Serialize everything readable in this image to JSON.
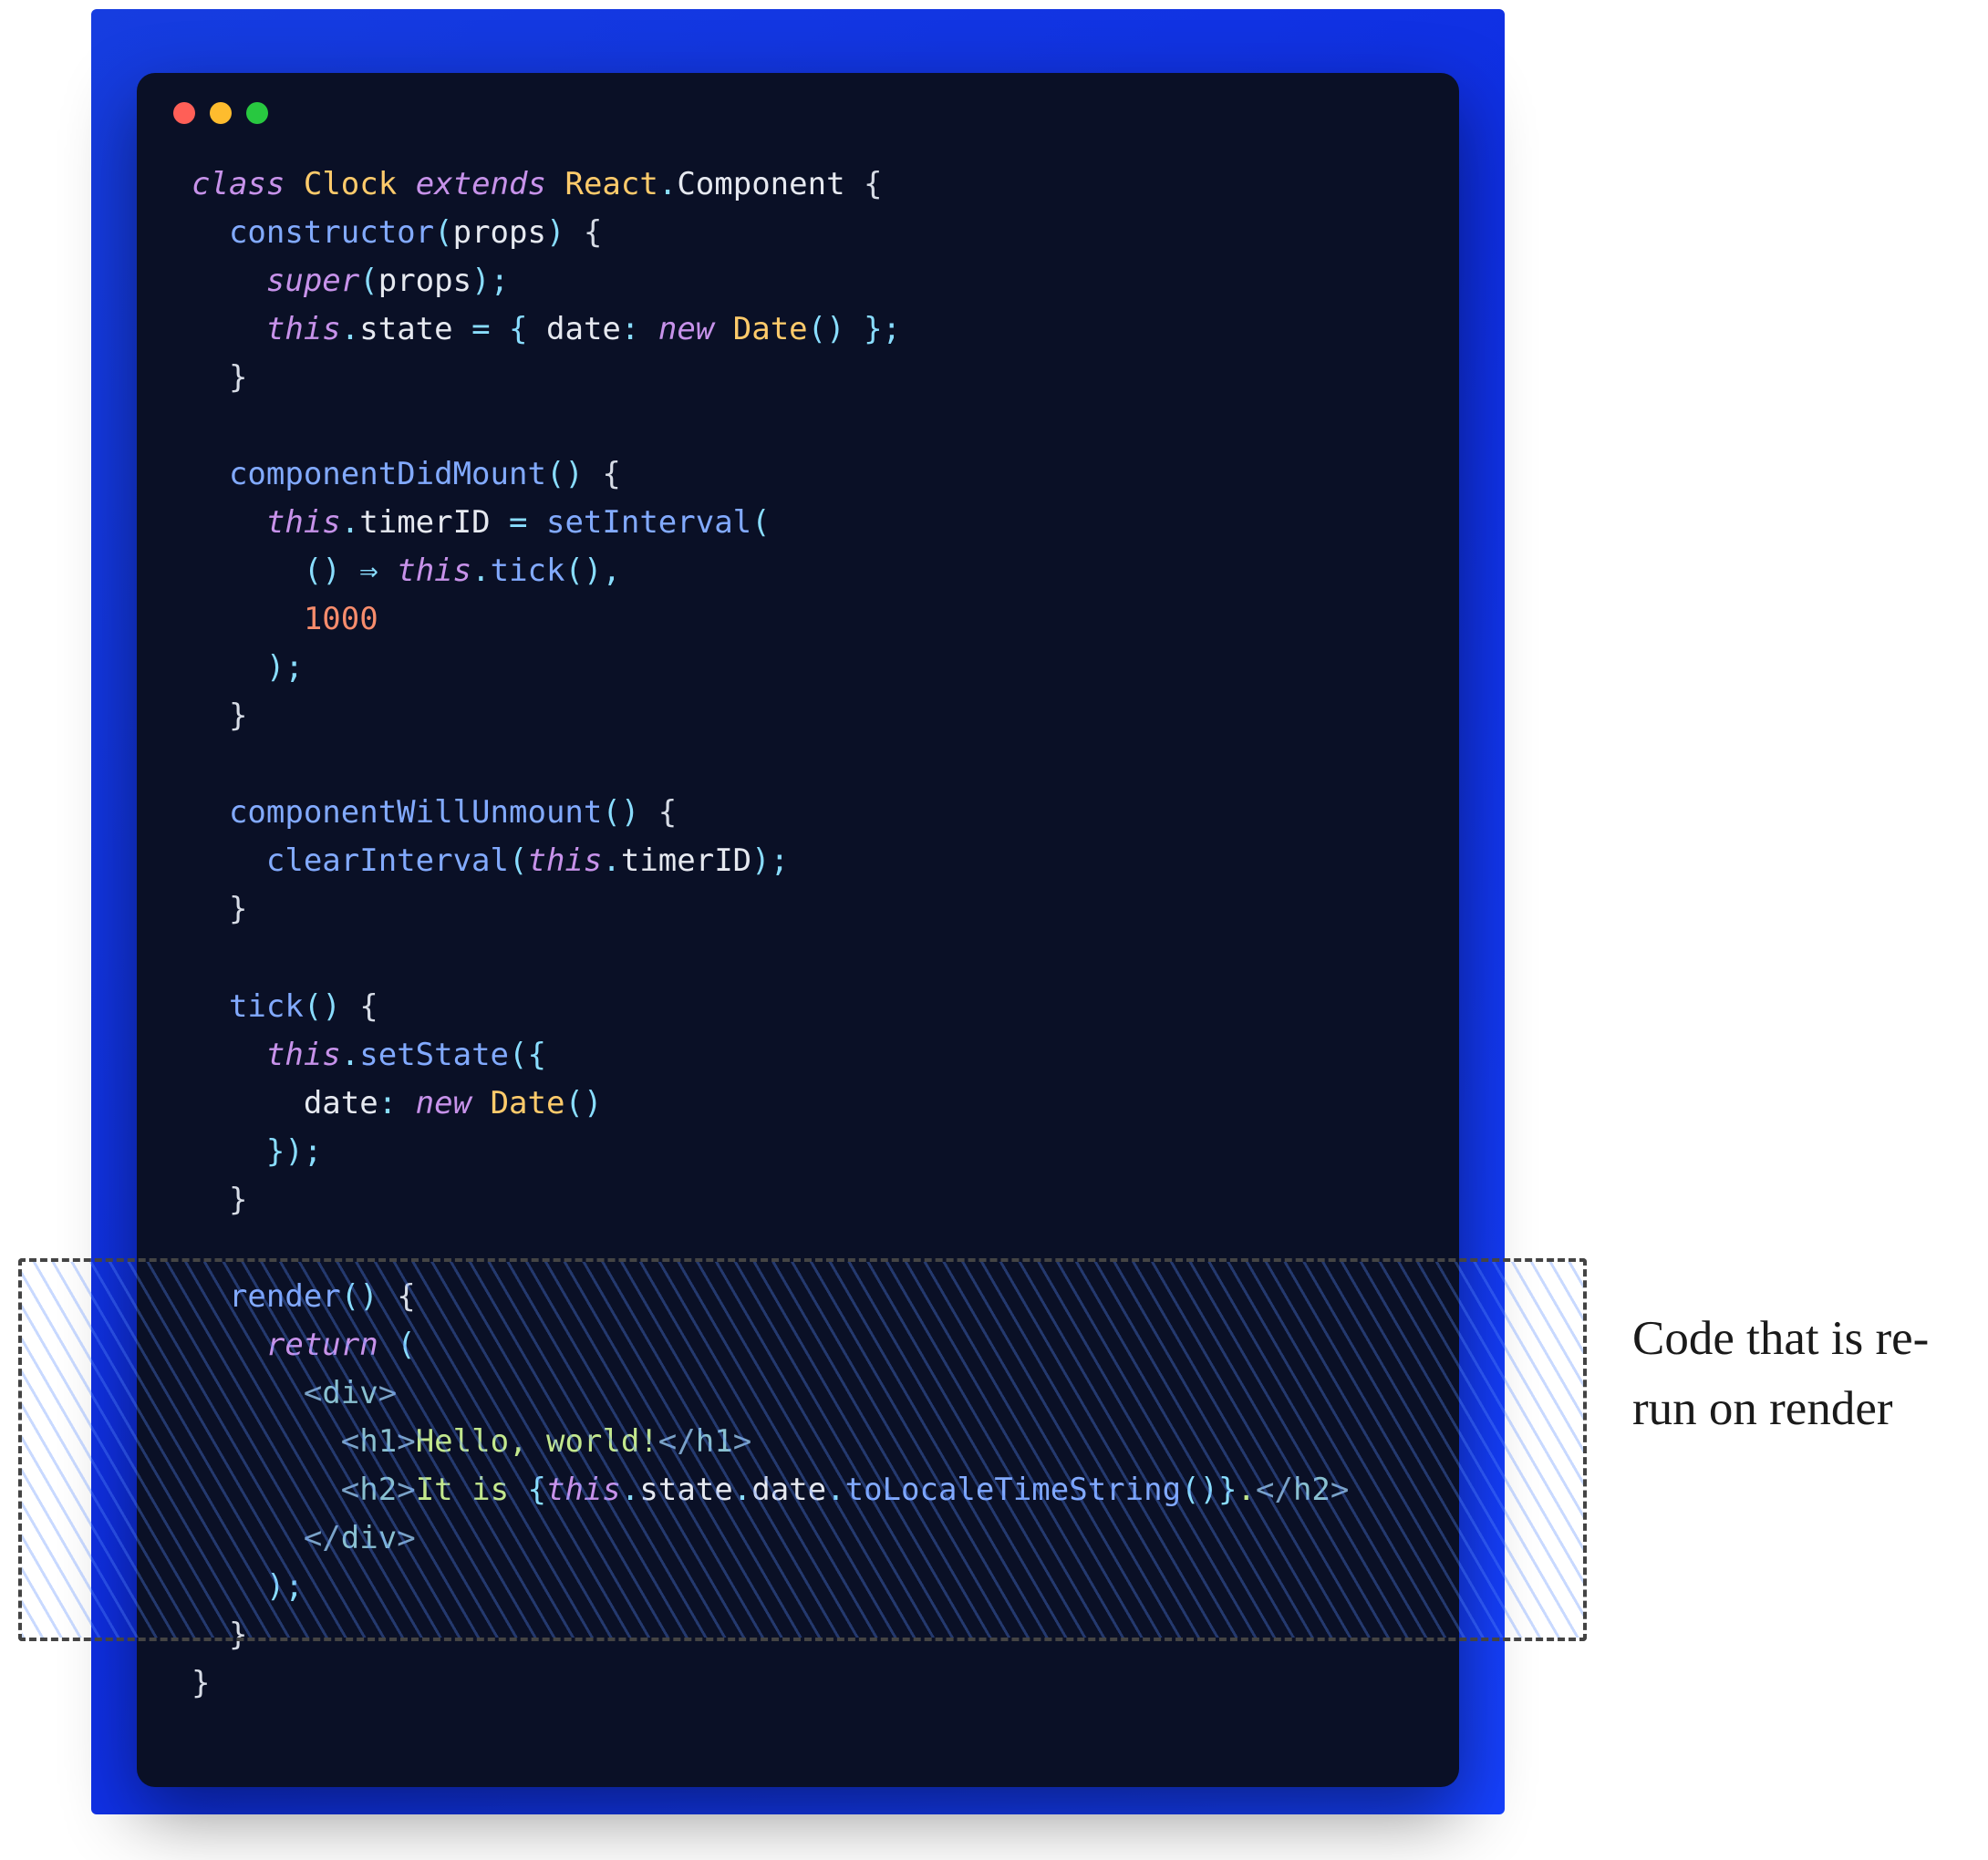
{
  "annotation": "Code that is re-run on render",
  "code": {
    "L01_class": "class",
    "L01_Clock": "Clock",
    "L01_extends": "extends",
    "L01_React": "React",
    "L01_dot": ".",
    "L01_Component": "Component",
    "L01_brace": " {",
    "L02_ctor": "constructor",
    "L02_paren_o": "(",
    "L02_props": "props",
    "L02_paren_c": ")",
    "L02_brace": " {",
    "L03_super": "super",
    "L03_po": "(",
    "L03_props": "props",
    "L03_pc": ")",
    "L03_semi": ";",
    "L04_this": "this",
    "L04_dot": ".",
    "L04_state": "state",
    "L04_eq": " = ",
    "L04_bo": "{ ",
    "L04_date": "date",
    "L04_colon": ": ",
    "L04_new": "new",
    "L04_sp": " ",
    "L04_Date": "Date",
    "L04_call": "()",
    "L04_bc": " }",
    "L04_semi": ";",
    "L05_cb": "}",
    "L07_cdm": "componentDidMount",
    "L07_paren": "()",
    "L07_brace": " {",
    "L08_this": "this",
    "L08_dot": ".",
    "L08_timer": "timerID",
    "L08_eq": " = ",
    "L08_si": "setInterval",
    "L08_po": "(",
    "L09_po": "(",
    "L09_pc": ")",
    "L09_arrow": " ⇒ ",
    "L09_this": "this",
    "L09_dot": ".",
    "L09_tick": "tick",
    "L09_call": "()",
    "L09_comma": ",",
    "L10_num": "1000",
    "L11_pc": ")",
    "L11_semi": ";",
    "L12_cb": "}",
    "L14_cwu": "componentWillUnmount",
    "L14_paren": "()",
    "L14_brace": " {",
    "L15_ci": "clearInterval",
    "L15_po": "(",
    "L15_this": "this",
    "L15_dot": ".",
    "L15_timer": "timerID",
    "L15_pc": ")",
    "L15_semi": ";",
    "L16_cb": "}",
    "L18_tick": "tick",
    "L18_paren": "()",
    "L18_brace": " {",
    "L19_this": "this",
    "L19_dot": ".",
    "L19_ss": "setState",
    "L19_po": "(",
    "L19_bo": "{",
    "L20_date": "date",
    "L20_colon": ": ",
    "L20_new": "new",
    "L20_sp": " ",
    "L20_Date": "Date",
    "L20_call": "()",
    "L21_bc": "}",
    "L21_pc": ")",
    "L21_semi": ";",
    "L22_cb": "}",
    "L24_render": "render",
    "L24_paren": "()",
    "L24_brace": " {",
    "L25_return": "return",
    "L25_po": " (",
    "L26_tag_o": "<",
    "L26_div": "div",
    "L26_tag_c": ">",
    "L27_tag_o": "<",
    "L27_h1": "h1",
    "L27_tag_c": ">",
    "L27_text": "Hello, world!",
    "L27_tag_co": "</",
    "L27_h1_2": "h1",
    "L27_tag_cc": ">",
    "L28_tag_o": "<",
    "L28_h2": "h2",
    "L28_tag_c": ">",
    "L28_txt1": "It is ",
    "L28_expr_o": "{",
    "L28_this": "this",
    "L28_d1": ".",
    "L28_state": "state",
    "L28_d2": ".",
    "L28_date": "date",
    "L28_d3": ".",
    "L28_fn": "toLocaleTimeString",
    "L28_call": "()",
    "L28_expr_c": "}",
    "L28_txt2": ".",
    "L28_tag_co": "</",
    "L28_h2_2": "h2",
    "L28_tag_cc": ">",
    "L29_tag_co": "</",
    "L29_div": "div",
    "L29_tag_cc": ">",
    "L30_pc": ")",
    "L30_semi": ";",
    "L31_cb": "}",
    "L32_cb": "}"
  }
}
